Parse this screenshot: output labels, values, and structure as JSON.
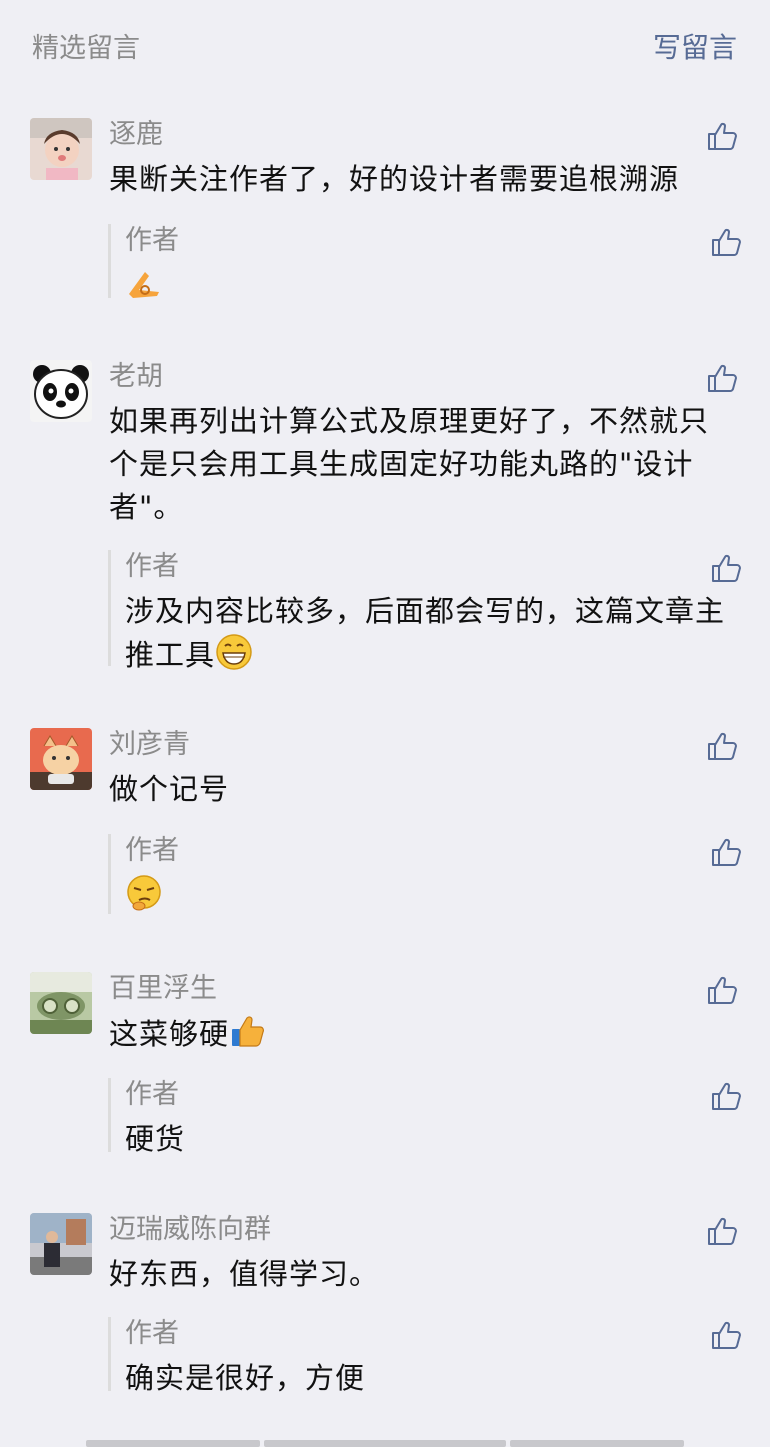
{
  "header": {
    "title": "精选留言",
    "write_label": "写留言"
  },
  "comments": [
    {
      "nickname": "逐鹿",
      "text": "果断关注作者了，好的设计者需要追根溯源",
      "reply": {
        "label": "作者",
        "text": ""
      }
    },
    {
      "nickname": "老胡",
      "text": "如果再列出计算公式及原理更好了，不然就只个是只会用工具生成固定好功能丸路的\"设计者\"。",
      "reply": {
        "label": "作者",
        "text": "涉及内容比较多，后面都会写的，这篇文章主推工具"
      }
    },
    {
      "nickname": "刘彦青",
      "text": "做个记号",
      "reply": {
        "label": "作者",
        "text": ""
      }
    },
    {
      "nickname": "百里浮生",
      "text": "这菜够硬",
      "reply": {
        "label": "作者",
        "text": "硬货"
      }
    },
    {
      "nickname": "迈瑞威陈向群",
      "text": "好东西，值得学习。",
      "reply": {
        "label": "作者",
        "text": "确实是很好，方便"
      }
    }
  ],
  "icons": {
    "like": "thumbs-up-outline-icon",
    "emoji_ok": "ok-hand-emoji",
    "emoji_grin": "grinning-emoji",
    "emoji_think": "thinking-smirk-emoji",
    "emoji_thumb": "thumbs-up-emoji"
  },
  "colors": {
    "link": "#576b95",
    "meta": "#8b8b8b",
    "background": "#efeff4"
  }
}
